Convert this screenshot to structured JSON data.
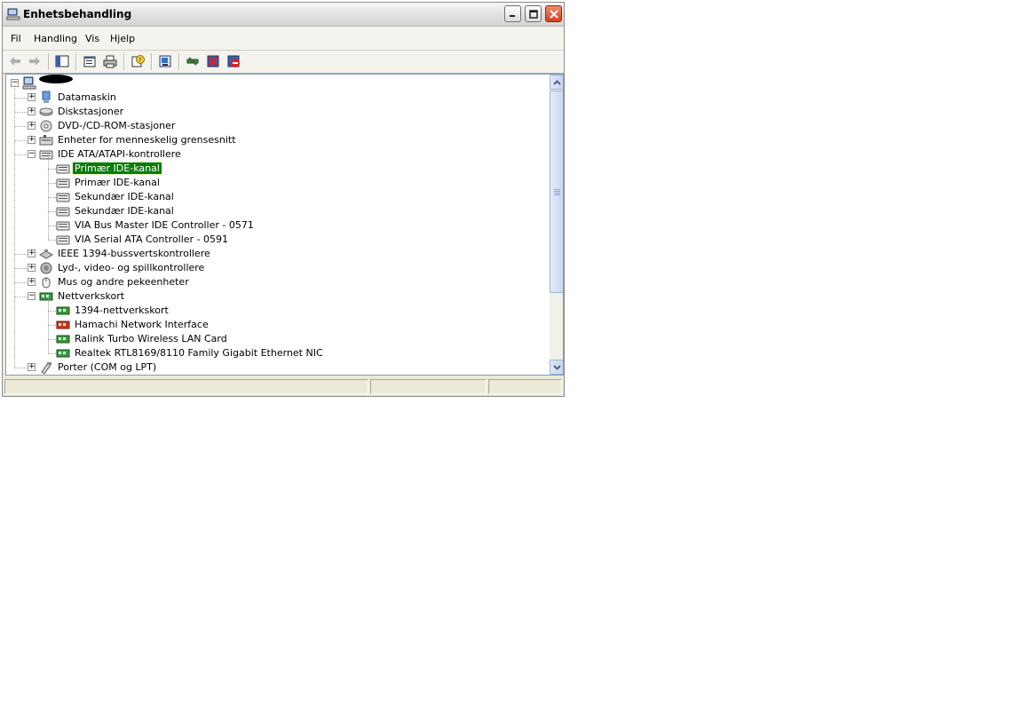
{
  "window": {
    "title": "Enhetsbehandling",
    "controls": {
      "minimize": "minimize",
      "maximize": "maximize",
      "close": "close"
    }
  },
  "menu": [
    "Fil",
    "Handling",
    "Vis",
    "Hjelp"
  ],
  "toolbar": {
    "icons": [
      "back-arrow-icon",
      "forward-arrow-icon",
      "show-hide-tree-icon",
      "properties-icon",
      "print-icon",
      "help-icon",
      "scan-hardware-icon",
      "update-driver-icon",
      "disable-device-icon",
      "uninstall-device-icon"
    ]
  },
  "tree": {
    "nodes": [
      {
        "label": "Datamaskin",
        "icon": "computer-icon",
        "level": 1,
        "expander": "+"
      },
      {
        "label": "Diskstasjoner",
        "icon": "disk-drive-icon",
        "level": 1,
        "expander": "+"
      },
      {
        "label": "DVD-/CD-ROM-stasjoner",
        "icon": "cdrom-icon",
        "level": 1,
        "expander": "+"
      },
      {
        "label": "Enheter for menneskelig grensesnitt",
        "icon": "hid-icon",
        "level": 1,
        "expander": "+"
      },
      {
        "label": "IDE ATA/ATAPI-kontrollere",
        "icon": "ide-controller-icon",
        "level": 1,
        "expander": "-"
      },
      {
        "label": "Primær IDE-kanal",
        "icon": "ide-channel-icon",
        "level": 2,
        "selected": true
      },
      {
        "label": "Primær IDE-kanal",
        "icon": "ide-channel-icon",
        "level": 2
      },
      {
        "label": "Sekundær IDE-kanal",
        "icon": "ide-channel-icon",
        "level": 2
      },
      {
        "label": "Sekundær IDE-kanal",
        "icon": "ide-channel-icon",
        "level": 2
      },
      {
        "label": "VIA Bus Master IDE Controller - 0571",
        "icon": "ide-channel-icon",
        "level": 2
      },
      {
        "label": "VIA Serial ATA Controller - 0591",
        "icon": "ide-channel-icon",
        "level": 2
      },
      {
        "label": "IEEE 1394-bussvertskontrollere",
        "icon": "ieee1394-icon",
        "level": 1,
        "expander": "+"
      },
      {
        "label": "Lyd-, video- og spillkontrollere",
        "icon": "sound-icon",
        "level": 1,
        "expander": "+"
      },
      {
        "label": "Mus og andre pekeenheter",
        "icon": "mouse-icon",
        "level": 1,
        "expander": "+"
      },
      {
        "label": "Nettverkskort",
        "icon": "network-adapter-icon",
        "level": 1,
        "expander": "-"
      },
      {
        "label": "1394-nettverkskort",
        "icon": "network-card-icon",
        "level": 2
      },
      {
        "label": "Hamachi Network Interface",
        "icon": "network-card-red-icon",
        "level": 2
      },
      {
        "label": "Ralink Turbo Wireless LAN Card",
        "icon": "network-card-icon",
        "level": 2
      },
      {
        "label": "Realtek RTL8169/8110 Family Gigabit Ethernet NIC",
        "icon": "network-card-icon",
        "level": 2
      },
      {
        "label": "Porter (COM og LPT)",
        "icon": "port-icon",
        "level": 1,
        "expander": "+"
      }
    ]
  },
  "colors": {
    "selection": "#0a7d0a",
    "pane_border": "#7f9db9",
    "window_bg": "#ece9d8"
  }
}
